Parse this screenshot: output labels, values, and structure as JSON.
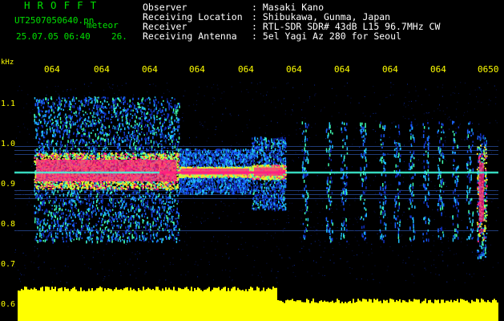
{
  "header": {
    "app_title": "HROFFT",
    "file_name": "UT2507050640.pn",
    "app_mode": "meteor",
    "date_time": "25.07.05 06:40",
    "level": "26.",
    "fields": [
      {
        "label": "Observer",
        "value": ": Masaki Kano"
      },
      {
        "label": "Receiving Location",
        "value": ": Shibukawa, Gunma, Japan"
      },
      {
        "label": "Receiver",
        "value": ": RTL-SDR SDR# 43dB L15 96.7MHz CW"
      },
      {
        "label": "Receiving Antenna",
        "value": ": 5el Yagi Az 280 for Seoul"
      }
    ]
  },
  "colors": {
    "label_green": "#00e000",
    "tick_yellow": "#ffff00",
    "text_white": "#ffffff",
    "signal_magenta": "#ff2080",
    "power_yellow": "#ffff00"
  },
  "chart_data": {
    "type": "heatmap",
    "ylabel": "kHz",
    "y_ticks": [
      "1.1",
      "1.0",
      "0.9",
      "0.8",
      "0.7",
      "0.6"
    ],
    "x_ticks": [
      "064",
      "064",
      "064",
      "064",
      "064",
      "064",
      "064",
      "064",
      "064",
      "0650"
    ],
    "ylim": [
      0.57,
      1.17
    ],
    "carrier_khz": 0.93,
    "reference_lines_khz": [
      0.995,
      0.985,
      0.975,
      0.885,
      0.875,
      0.865,
      0.785
    ],
    "events": [
      {
        "x": [
          0.04,
          0.34
        ],
        "core_khz": [
          0.89,
          0.98
        ],
        "spread_khz": [
          0.76,
          1.12
        ],
        "intensity": 1.0
      },
      {
        "x": [
          0.34,
          0.49
        ],
        "core_khz": [
          0.92,
          0.945
        ],
        "spread_khz": [
          0.88,
          0.99
        ],
        "intensity": 0.8
      },
      {
        "x": [
          0.49,
          0.56
        ],
        "core_khz": [
          0.915,
          0.95
        ],
        "spread_khz": [
          0.84,
          1.02
        ],
        "intensity": 0.9
      },
      {
        "x": [
          0.955,
          0.975
        ],
        "core_khz": [
          0.76,
          1.0
        ],
        "spread_khz": [
          0.72,
          1.03
        ],
        "intensity": 1.0
      }
    ],
    "faint_bursts_x": [
      0.6,
      0.65,
      0.68,
      0.72,
      0.76,
      0.79,
      0.82,
      0.85,
      0.88,
      0.91,
      0.94
    ],
    "power_level": {
      "left_part": 0.64,
      "right_part": 0.61
    }
  }
}
